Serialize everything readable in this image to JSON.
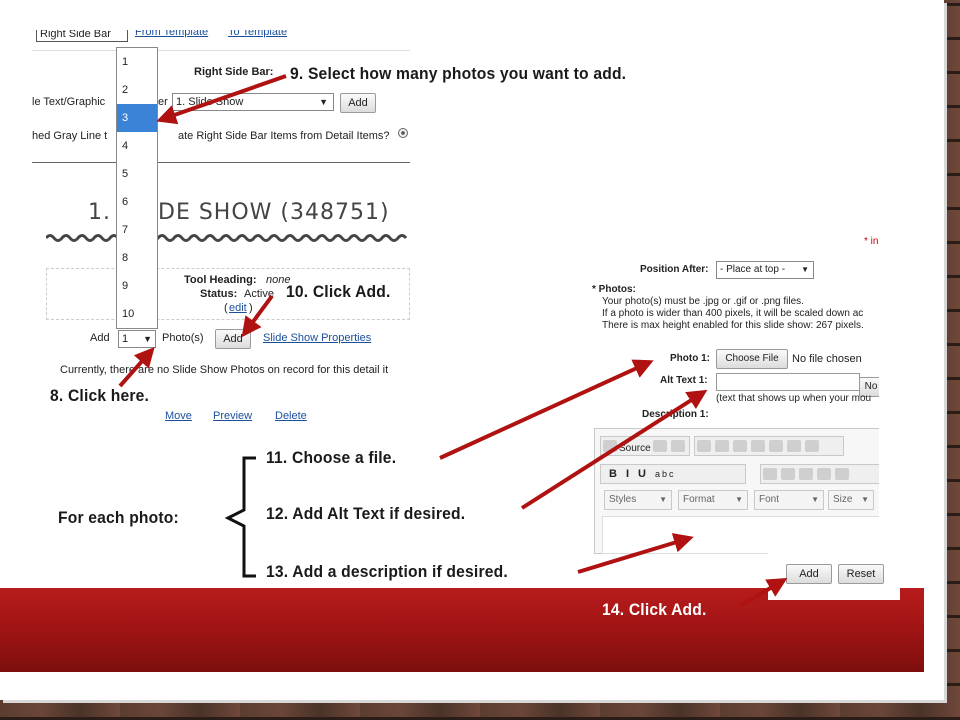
{
  "captions": {
    "step8": "8.  Click here.",
    "step9": "9.  Select how many photos you want to add.",
    "step10": "10.  Click Add.",
    "step11": "11.   Choose a file.",
    "step12": "12.  Add Alt Text if desired.",
    "step13": "13.  Add a description if desired.",
    "step14": "14.  Click Add.",
    "for_each": "For each photo:"
  },
  "shot_a": {
    "tab_label": "Right Side Bar",
    "from_template": "From Template",
    "to_template": "To Template",
    "right_side_bar_label": "Right Side Bar:",
    "left_field_text": "le Text/Graphic",
    "left_field_suffix": "er",
    "slide_show_select": "1. Slide Show",
    "add_top": "Add",
    "gray_line_text": "hed Gray Line t",
    "gray_line_text2": "ate Right Side Bar Items from Detail Items?",
    "heading_left": "1. S",
    "heading_right": "DE SHOW (348751)",
    "tool_heading_label": "Tool Heading:",
    "tool_heading_value": "none",
    "status_label": "Status:",
    "status_value": "Active",
    "edit_link": "edit",
    "add_label": "Add",
    "count_value": "1",
    "photos_label": "Photo(s)",
    "add_button": "Add",
    "slide_show_properties": "Slide Show Properties",
    "no_photos_msg": "Currently, there are no Slide Show Photos on record for this detail it",
    "move": "Move",
    "preview": "Preview",
    "delete": "Delete",
    "dropdown_options": [
      "1",
      "2",
      "3",
      "4",
      "5",
      "6",
      "7",
      "8",
      "9",
      "10"
    ],
    "dropdown_selected": "3"
  },
  "shot_b": {
    "required_note": "* in",
    "position_after_label": "Position After:",
    "position_after_value": "- Place at top -",
    "photos_label": "* Photos:",
    "note1": "Your photo(s) must be .jpg or .gif or .png files.",
    "note2": "If a photo is wider than 400 pixels, it will be scaled down ac",
    "note3": "There is max height enabled for this slide show: 267 pixels.",
    "photo1_label": "Photo 1:",
    "choose_file": "Choose File",
    "no_file": "No file chosen",
    "alt_text_label": "Alt Text 1:",
    "alt_button_partial": "No",
    "alt_hint": "(text that shows up when your mou",
    "description_label": "Description 1:",
    "source": "Source",
    "styles": "Styles",
    "format": "Format",
    "font": "Font",
    "size": "Size"
  },
  "shot_c": {
    "add": "Add",
    "reset": "Reset"
  },
  "colors": {
    "arrow": "#b01212",
    "band": "#a81616",
    "highlight": "#3b83d6"
  }
}
